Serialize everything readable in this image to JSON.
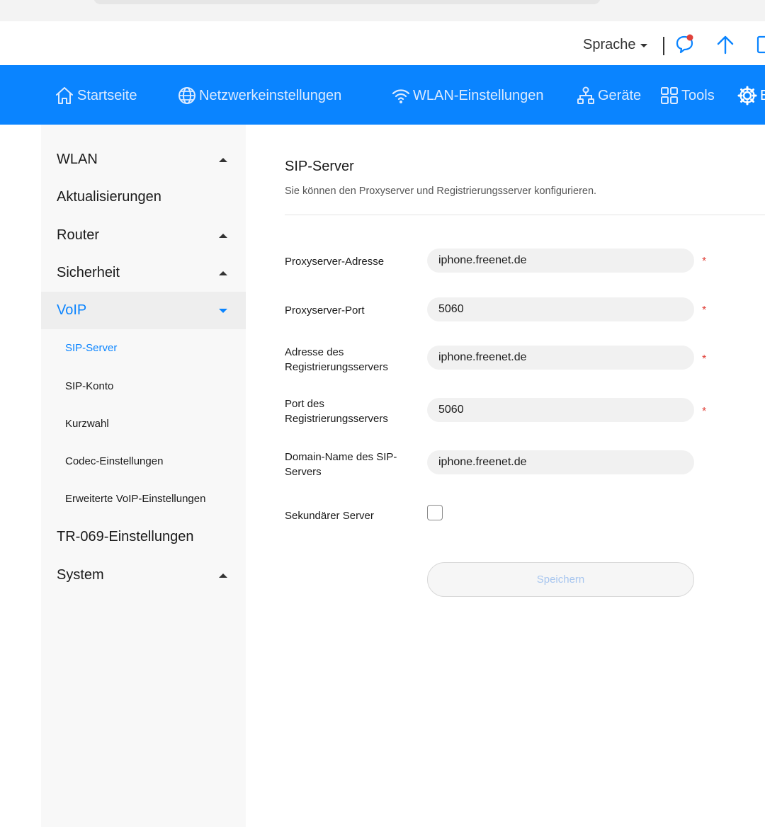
{
  "header": {
    "language_label": "Sprache"
  },
  "nav": {
    "items": [
      {
        "label": "Startseite",
        "icon": "home-icon"
      },
      {
        "label": "Netzwerkeinstellungen",
        "icon": "globe-icon"
      },
      {
        "label": "WLAN-Einstellungen",
        "icon": "wifi-icon"
      },
      {
        "label": "Geräte",
        "icon": "devices-icon"
      },
      {
        "label": "Tools",
        "icon": "tools-grid-icon"
      },
      {
        "label": "E",
        "icon": "gear-icon"
      }
    ]
  },
  "sidebar": {
    "items": [
      {
        "label": "WLAN"
      },
      {
        "label": "Aktualisierungen"
      },
      {
        "label": "Router"
      },
      {
        "label": "Sicherheit"
      },
      {
        "label": "VoIP"
      },
      {
        "label": "TR-069-Einstellungen"
      },
      {
        "label": "System"
      }
    ],
    "voip_sub": [
      {
        "label": "SIP-Server"
      },
      {
        "label": "SIP-Konto"
      },
      {
        "label": "Kurzwahl"
      },
      {
        "label": "Codec-Einstellungen"
      },
      {
        "label": "Erweiterte VoIP-Einstellungen"
      }
    ]
  },
  "main": {
    "title": "SIP-Server",
    "description": "Sie können den Proxyserver und Registrierungsserver konfigurieren.",
    "fields": {
      "proxy_address": {
        "label": "Proxyserver-Adresse",
        "value": "iphone.freenet.de"
      },
      "proxy_port": {
        "label": "Proxyserver-Port",
        "value": "5060"
      },
      "registrar_address": {
        "label": "Adresse des Registrierungsservers",
        "value": "iphone.freenet.de"
      },
      "registrar_port": {
        "label": "Port des Registrierungsservers",
        "value": "5060"
      },
      "sip_domain": {
        "label": "Domain-Name des SIP-Servers",
        "value": "iphone.freenet.de"
      },
      "secondary_server": {
        "label": "Sekundärer Server",
        "checked": false
      }
    },
    "required_mark": "*",
    "save_label": "Speichern"
  },
  "colors": {
    "accent": "#0a84ff",
    "required": "#e0413a"
  }
}
